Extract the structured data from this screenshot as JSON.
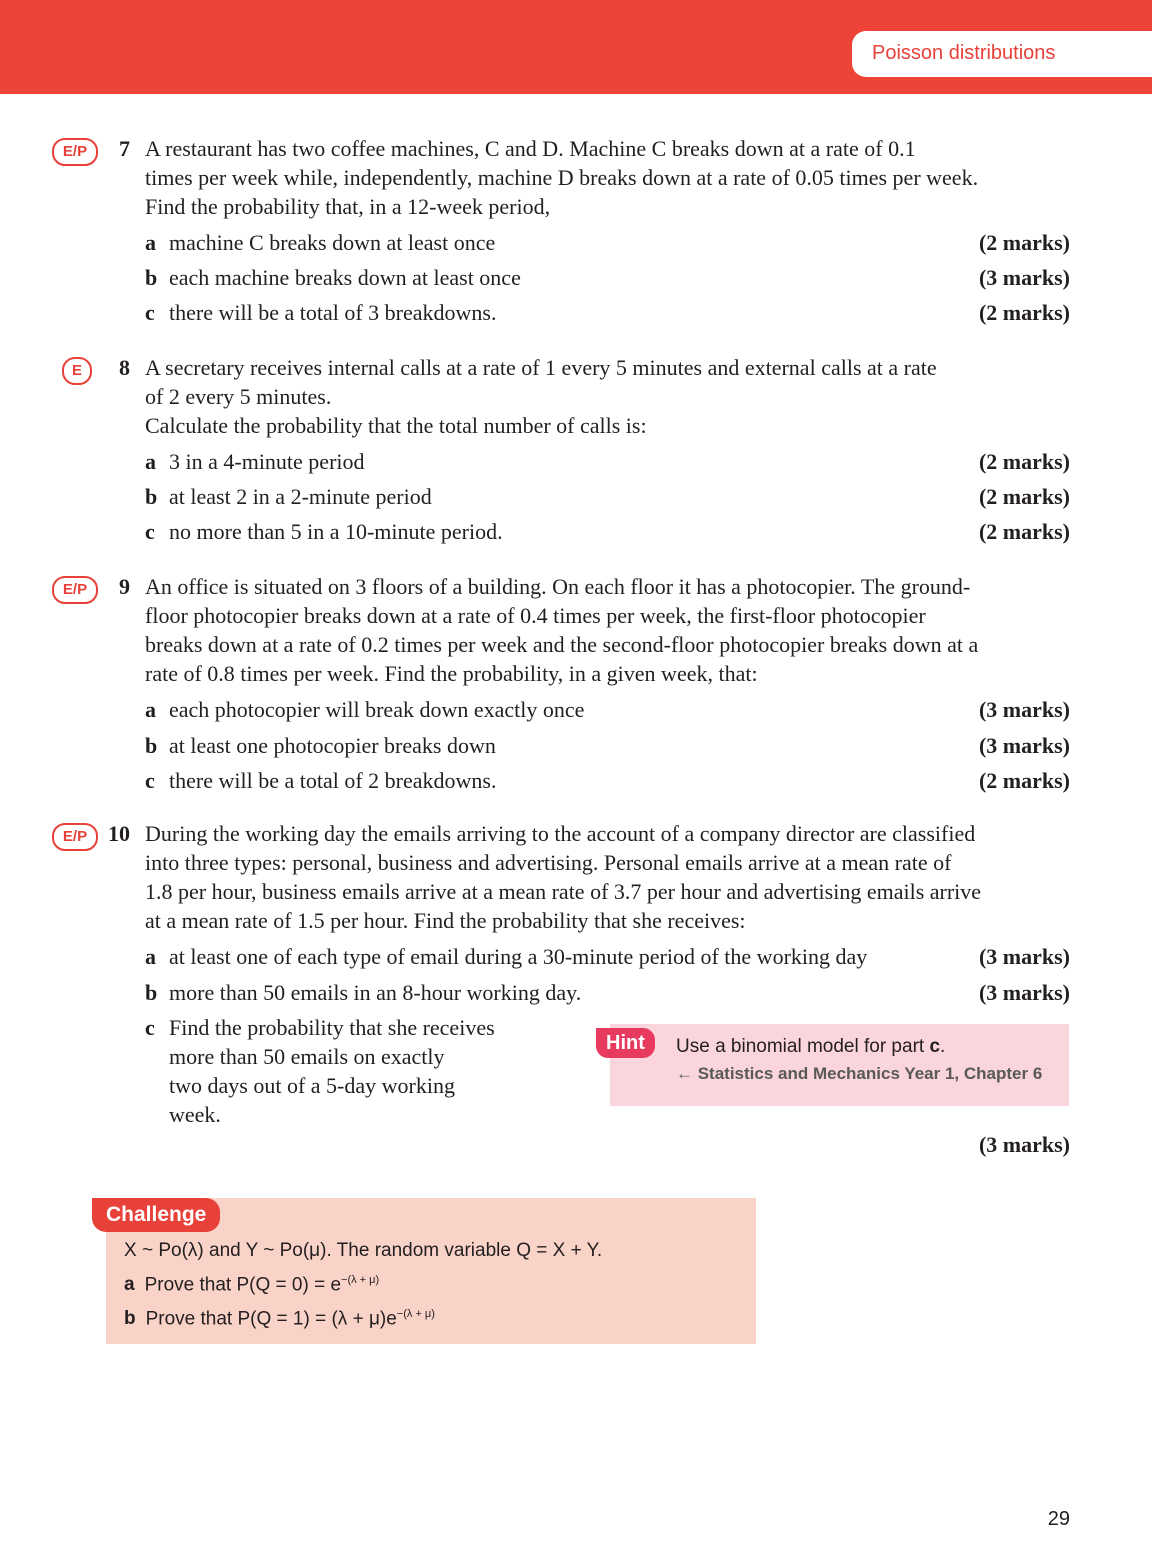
{
  "header": {
    "section_title": "Poisson distributions"
  },
  "questions": [
    {
      "badge": "E/P",
      "number": "7",
      "stem": [
        "A restaurant has two coffee machines, C and D. Machine C breaks down at a rate of 0.1",
        "times per week while, independently, machine D breaks down at a rate of 0.05 times per week.",
        "Find the probability that, in a 12-week period,"
      ],
      "parts": [
        {
          "label": "a",
          "text": "machine C breaks down at least once",
          "marks": "(2 marks)"
        },
        {
          "label": "b",
          "text": "each machine breaks down at least once",
          "marks": "(3 marks)"
        },
        {
          "label": "c",
          "text": "there will be a total of 3 breakdowns.",
          "marks": "(2 marks)"
        }
      ]
    },
    {
      "badge": "E",
      "number": "8",
      "stem": [
        "A secretary receives internal calls at a rate of 1 every 5 minutes and external calls at a rate",
        "of 2 every 5 minutes.",
        "Calculate the probability that the total number of calls is:"
      ],
      "parts": [
        {
          "label": "a",
          "text": "3 in a 4-minute period",
          "marks": "(2 marks)"
        },
        {
          "label": "b",
          "text": "at least 2 in a 2-minute period",
          "marks": "(2 marks)"
        },
        {
          "label": "c",
          "text": "no more than 5 in a 10-minute period.",
          "marks": "(2 marks)"
        }
      ]
    },
    {
      "badge": "E/P",
      "number": "9",
      "stem": [
        "An office is situated on 3 floors of a building. On each floor it has a photocopier. The ground-",
        "floor photocopier breaks down at a rate of 0.4 times per week, the first-floor photocopier",
        "breaks down at a rate of 0.2 times per week and the second-floor photocopier breaks down at a",
        "rate of 0.8 times per week. Find the probability, in a given week, that:"
      ],
      "parts": [
        {
          "label": "a",
          "text": "each photocopier will break down exactly once",
          "marks": "(3 marks)"
        },
        {
          "label": "b",
          "text": "at least one photocopier breaks down",
          "marks": "(3 marks)"
        },
        {
          "label": "c",
          "text": "there will be a total of 2 breakdowns.",
          "marks": "(2 marks)"
        }
      ]
    },
    {
      "badge": "E/P",
      "number": "10",
      "stem": [
        "During the working day the emails arriving to the account of a company director are classified",
        "into three types: personal, business and advertising. Personal emails arrive at a mean rate of",
        "1.8 per hour, business emails arrive at a mean rate of 3.7 per hour and advertising emails arrive",
        "at a mean rate of 1.5 per hour. Find the probability that she receives:"
      ],
      "parts": [
        {
          "label": "a",
          "text": "at least one of each type of email during a 30-minute period of the working day",
          "marks": "(3 marks)"
        },
        {
          "label": "b",
          "text": "more than 50 emails in an 8-hour working day.",
          "marks": "(3 marks)"
        },
        {
          "label": "c",
          "text_lines": [
            "Find the probability that she receives",
            "more than 50 emails on exactly",
            "two days out of a 5-day working",
            "week."
          ],
          "marks": "(3 marks)"
        }
      ]
    }
  ],
  "hint": {
    "tag": "Hint",
    "text_prefix": "Use a binomial model for part ",
    "text_bold": "c",
    "text_suffix": ".",
    "reference": "← Statistics and Mechanics Year 1, Chapter 6"
  },
  "challenge": {
    "tag": "Challenge",
    "intro": "X ~ Po(λ) and Y ~ Po(μ). The random variable Q = X + Y.",
    "parts": [
      {
        "label": "a",
        "text": "Prove that P(Q = 0) = e",
        "sup": "−(λ + μ)"
      },
      {
        "label": "b",
        "text": "Prove that P(Q = 1) = (λ + μ)e",
        "sup": "−(λ + μ)"
      }
    ]
  },
  "page_number": "29",
  "colors": {
    "header": "#ee4437",
    "badge": "#e8413a",
    "hint_bg": "#fbd5dc",
    "hint_tag": "#e8395f",
    "challenge_bg": "#f9d3c8"
  }
}
